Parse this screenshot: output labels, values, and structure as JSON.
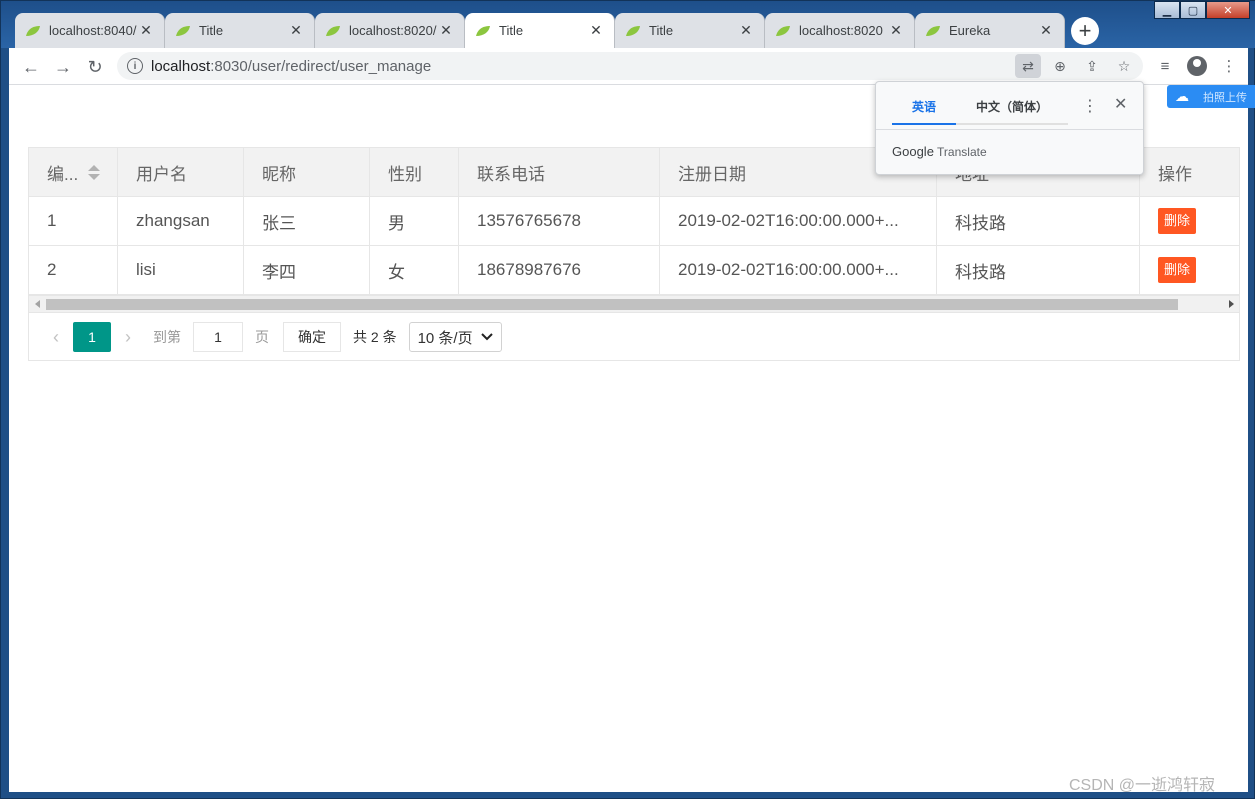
{
  "window": {
    "controls": {
      "minimize": "▁",
      "maximize": "▢",
      "close": "✕"
    }
  },
  "tabs": [
    {
      "title": "localhost:8040/",
      "active": false
    },
    {
      "title": "Title",
      "active": false
    },
    {
      "title": "localhost:8020/",
      "active": false
    },
    {
      "title": "Title",
      "active": true
    },
    {
      "title": "Title",
      "active": false
    },
    {
      "title": "localhost:8020",
      "active": false
    },
    {
      "title": "Eureka",
      "active": false
    }
  ],
  "toolbar": {
    "url_host": "localhost",
    "url_path": ":8030/user/redirect/user_manage"
  },
  "table": {
    "headers": [
      "编...",
      "用户名",
      "昵称",
      "性别",
      "联系电话",
      "注册日期",
      "地址",
      "操作"
    ],
    "rows": [
      [
        "1",
        "zhangsan",
        "张三",
        "男",
        "13576765678",
        "2019-02-02T16:00:00.000+...",
        "科技路",
        "删除"
      ],
      [
        "2",
        "lisi",
        "李四",
        "女",
        "18678987676",
        "2019-02-02T16:00:00.000+...",
        "科技路",
        "删除"
      ]
    ]
  },
  "pager": {
    "current_page": "1",
    "goto_label": "到第",
    "goto_value": "1",
    "page_label": "页",
    "confirm": "确定",
    "total": "共 2 条",
    "page_size": "10 条/页"
  },
  "translate_popup": {
    "source_lang": "英语",
    "target_lang": "中文（简体）",
    "brand": "Google",
    "product": "Translate"
  },
  "side_widget": {
    "label": "拍照上传"
  },
  "watermark": "CSDN @一逝鸿轩寂",
  "colors": {
    "accent": "#009688",
    "danger": "#ff5722",
    "google_blue": "#1a73e8"
  }
}
